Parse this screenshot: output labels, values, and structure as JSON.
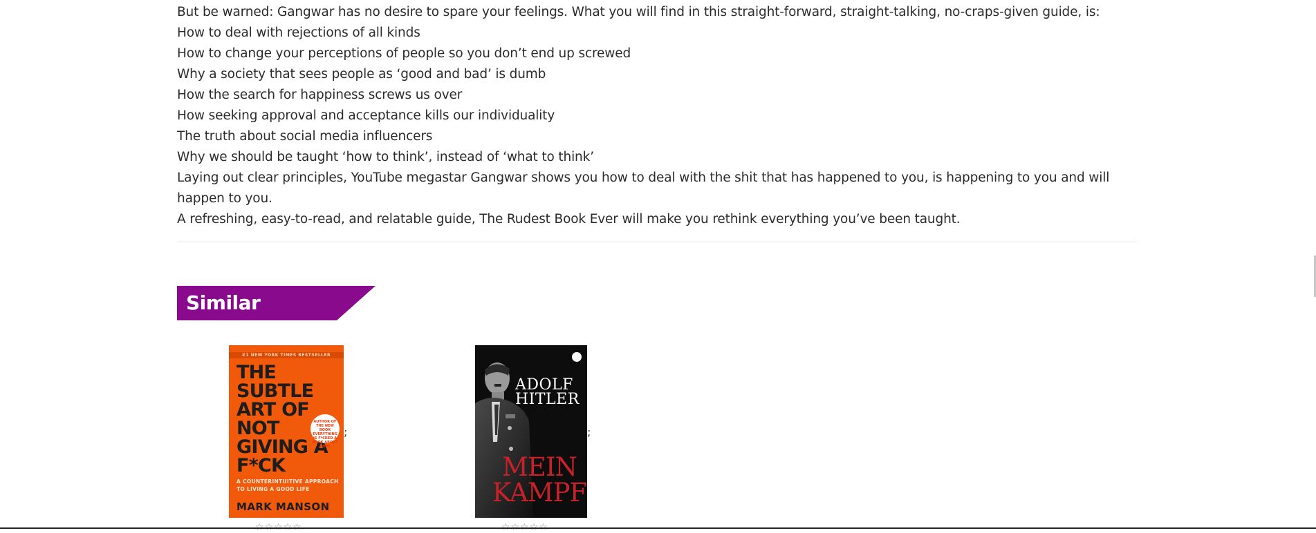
{
  "description": {
    "intro": "But be warned: Gangwar has no desire to spare your feelings. What you will find in this straight-forward, straight-talking, no-craps-given guide, is:",
    "points": [
      "How to deal with rejections of all kinds",
      "How to change your perceptions of people so you don’t end up screwed",
      "Why a society that sees people as ‘good and bad’ is dumb",
      "How the search for happiness screws us over",
      "How seeking approval and acceptance kills our individuality",
      "The truth about social media influencers",
      "Why we should be taught ‘how to think’, instead of ‘what to think’"
    ],
    "closing_1": "Laying out clear principles, YouTube megastar Gangwar shows you how to deal with the shit that has happened to you, is happening to you and will happen to you.",
    "closing_2": "A refreshing, easy-to-read, and relatable guide, The Rudest Book Ever will make you rethink everything you’ve been taught."
  },
  "similar": {
    "heading": "Similar",
    "banner_color": "#8a0a8e",
    "books": [
      {
        "title": "The Subtle Art of Not Giving a F*ck",
        "cover_color": "#f25a0b",
        "cover_topline": "#1 NEW YORK TIMES BESTSELLER",
        "cover_title": "THE SUBTLE ART OF NOT GIVING A F*CK",
        "cover_sticker": "AUTHOR OF THE NEW BOOK EVERYTHING IS F*CKED A BOOK ABOUT HOPE",
        "cover_subtitle": "A COUNTERINTUITIVE APPROACH TO LIVING A GOOD LIFE",
        "cover_author": "MARK MANSON",
        "separator": ";",
        "rating_icon": "star-outline-icon"
      },
      {
        "title": "Mein Kampf",
        "cover_color": "#0d0d0d",
        "cover_author": "ADOLF HITLER",
        "cover_title": "MEIN KAMPF",
        "separator": ";",
        "rating_icon": "star-outline-icon"
      }
    ]
  }
}
